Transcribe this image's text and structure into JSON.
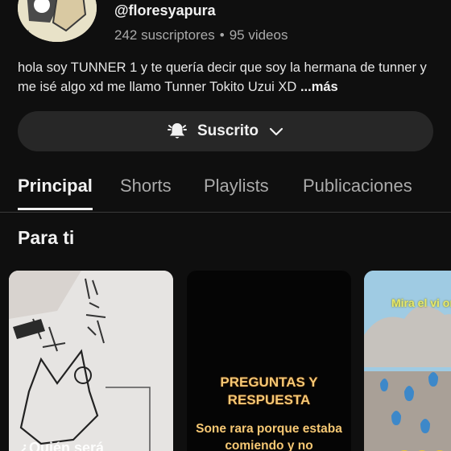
{
  "channel": {
    "handle": "@floresyapura",
    "subscribers": "242 suscriptores",
    "separator": "•",
    "videos": "95 videos",
    "description": "hola soy TUNNER 1 y te quería decir que soy la hermana de tunner y me isé algo xd me llamo Tunner Tokito Uzui XD ",
    "more_label": "...más"
  },
  "subscribe_button": {
    "label": "Suscrito",
    "icon": "bell-icon",
    "chevron": "chevron-down-icon"
  },
  "tabs": [
    {
      "label": "Principal",
      "active": true
    },
    {
      "label": "Shorts",
      "active": false
    },
    {
      "label": "Playlists",
      "active": false
    },
    {
      "label": "Publicaciones",
      "active": false
    }
  ],
  "section": {
    "title": "Para ti"
  },
  "cards": [
    {
      "overlay_text": "¿Quién será"
    },
    {
      "title_text": "PREGUNTAS Y RESPUESTA",
      "sub_text": "Sone rara porque estaba comiendo y no"
    },
    {
      "overlay_text": "Mira el vi orgina"
    }
  ],
  "colors": {
    "background": "#0f0f0f",
    "button_bg": "#272727",
    "secondary_text": "#aaaaaa",
    "card_text_gold": "#f6c874"
  }
}
